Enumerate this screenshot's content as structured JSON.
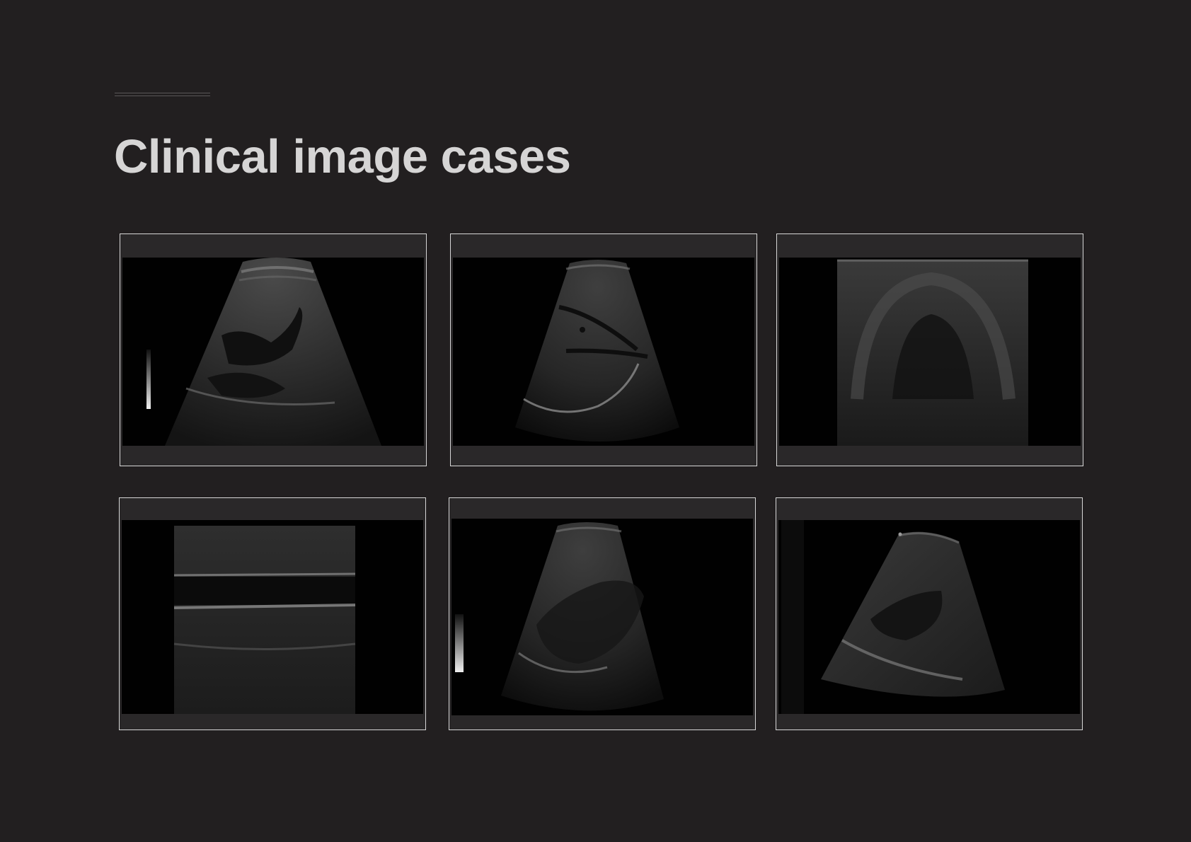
{
  "page": {
    "title": "Clinical image cases",
    "background_color": "#221f20",
    "title_color": "#d6d5d5",
    "frame_color": "#d7d7d7"
  },
  "cases": [
    {
      "view": "liver-sector-scan",
      "has_gray_scale_bar": true
    },
    {
      "view": "liver-sector-scan-vessels",
      "has_gray_scale_bar": false
    },
    {
      "view": "linear-array-transverse-scan",
      "has_gray_scale_bar": false
    },
    {
      "view": "linear-array-longitudinal-vessel",
      "has_gray_scale_bar": false
    },
    {
      "view": "liver-kidney-sector-scan",
      "has_gray_scale_bar": true
    },
    {
      "view": "kidney-oblique-sector-scan",
      "has_gray_scale_bar": false
    }
  ]
}
